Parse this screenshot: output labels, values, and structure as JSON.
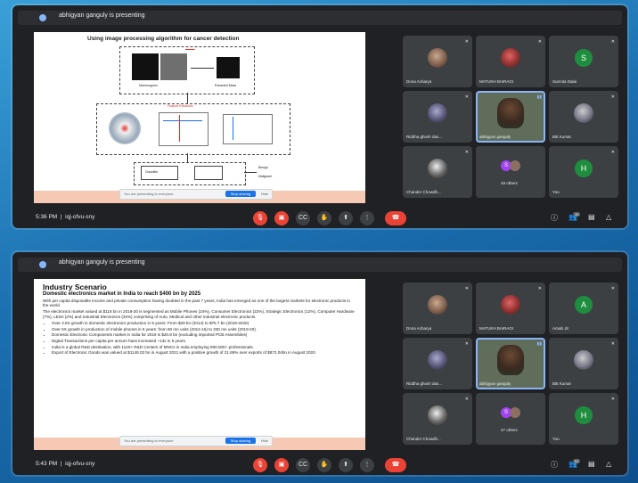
{
  "panels": [
    {
      "presenting_text": "abhigyan ganguly is presenting",
      "time": "5:36 PM",
      "meeting_code": "iqj-ofvu-sny",
      "participants_badge": "10",
      "slide": {
        "title": "Using image processing algorithm for cancer detection",
        "labels": [
          "Mammogram",
          "Extracted Mass",
          "Feature Extraction",
          "Classifier",
          "Benign",
          "Malignant"
        ]
      },
      "tiles": [
        {
          "name": "Dona Acharya",
          "kind": "photo"
        },
        {
          "name": "MATUKH BAIRAGI",
          "kind": "photo"
        },
        {
          "name": "Surmita Dalai",
          "kind": "letter",
          "letter": "S",
          "color": "#1e8e3e"
        },
        {
          "name": "Riddha ghosh das...",
          "kind": "photo"
        },
        {
          "name": "abhigyan ganguly",
          "kind": "presenter"
        },
        {
          "name": "Bitt Kumar",
          "kind": "photo"
        },
        {
          "name": "Chander Chowdh...",
          "kind": "photo"
        },
        {
          "name": "49 others",
          "kind": "others"
        },
        {
          "name": "You",
          "kind": "letter",
          "letter": "H",
          "color": "#1e8e3e"
        }
      ]
    },
    {
      "presenting_text": "abhigyan ganguly is presenting",
      "time": "5:43 PM",
      "meeting_code": "iqj-ofvu-sny",
      "participants_badge": "51",
      "slide": {
        "title": "Industry Scenario",
        "subtitle": "Domestic electronics market in India to reach $400 bn by 2025",
        "p1": "With per capita disposable income and private consumption having doubled in the past 7 years, India has emerged as one of the largest markets for electronic products in the world.",
        "p2": "The electronics market valued at $118 bn in 2019-20 is segmented as Mobile Phones (24%), Consumer Electronics (22%), Strategic Electronics (12%), Computer Hardware (7%), LEDs (2%) and Industrial Electronics (34%) comprising of Auto, Medical and other industrial electronic products.",
        "bullets": [
          "Over 2.5X growth in domestic electronics production in 5 years: From $29 bn (2014) to $75.7 bn (2019-2020)",
          "Over 5X growth in production of mobile phones in 5 years: from 60 mn units (2014-15) to 330 mn units (2019-20).",
          "Domestic Electronic Components market in India for 2019 is $20.8 bn (excluding imported PCB Assemblies)",
          "Digital Transactions per capita per annum have increased ~13x in 5 years.",
          "India is a global R&D destination, with 1140+ R&D Centers of MNCs in India employing 900,000+ professionals.",
          "Export of Electronic Goods was valued at $1146.03 bn in August 2021 with a positive growth of 21.69% over exports of $872.04bn in August 2020."
        ]
      },
      "tiles": [
        {
          "name": "Dona Acharya",
          "kind": "photo"
        },
        {
          "name": "MATUKH BAIRAGI",
          "kind": "photo"
        },
        {
          "name": "Arnab Jit",
          "kind": "letter",
          "letter": "A",
          "color": "#1e8e3e"
        },
        {
          "name": "Riddha ghosh das...",
          "kind": "photo"
        },
        {
          "name": "abhigyan ganguly",
          "kind": "presenter"
        },
        {
          "name": "Bitt Kumar",
          "kind": "photo"
        },
        {
          "name": "Chander Chowdh...",
          "kind": "photo"
        },
        {
          "name": "47 others",
          "kind": "others"
        },
        {
          "name": "You",
          "kind": "letter",
          "letter": "H",
          "color": "#1e8e3e"
        }
      ]
    }
  ],
  "share_notice": {
    "text": "You are presenting to everyone",
    "stop": "Stop sharing",
    "hide": "Hide"
  },
  "controls": {
    "mic": "mic-off-icon",
    "camera": "camera-off-icon",
    "captions": "captions-icon",
    "hand": "raise-hand-icon",
    "present": "present-icon",
    "more": "more-vertical-icon",
    "end": "end-call-icon"
  },
  "colors": {
    "accent": "#8ab4f8",
    "danger": "#ea4335",
    "background": "#202124"
  }
}
